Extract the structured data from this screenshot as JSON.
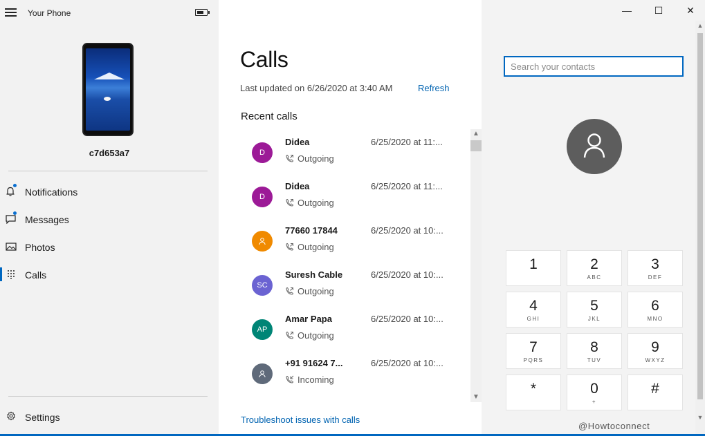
{
  "app": {
    "title": "Your Phone",
    "battery_level": 0.75
  },
  "device": {
    "name": "c7d653a7"
  },
  "nav": {
    "items": [
      {
        "id": "notifications",
        "label": "Notifications",
        "icon": "bell-icon",
        "badge": true
      },
      {
        "id": "messages",
        "label": "Messages",
        "icon": "message-icon",
        "badge": true
      },
      {
        "id": "photos",
        "label": "Photos",
        "icon": "image-icon",
        "badge": false
      },
      {
        "id": "calls",
        "label": "Calls",
        "icon": "dialpad-icon",
        "badge": false,
        "active": true
      }
    ],
    "settings_label": "Settings"
  },
  "main": {
    "title": "Calls",
    "last_updated": "Last updated on 6/26/2020 at 3:40 AM",
    "refresh_label": "Refresh",
    "recent_heading": "Recent calls",
    "troubleshoot_label": "Troubleshoot issues with calls",
    "calls": [
      {
        "name": "Didea",
        "initials": "D",
        "color": "#9c1a97",
        "time": "6/25/2020 at 11:...",
        "direction": "Outgoing"
      },
      {
        "name": "Didea",
        "initials": "D",
        "color": "#9c1a97",
        "time": "6/25/2020 at 11:...",
        "direction": "Outgoing"
      },
      {
        "name": "77660 17844",
        "initials": "",
        "color": "#f08a00",
        "time": "6/25/2020 at 10:...",
        "direction": "Outgoing"
      },
      {
        "name": "Suresh Cable",
        "initials": "SC",
        "color": "#6b63d2",
        "time": "6/25/2020 at 10:...",
        "direction": "Outgoing"
      },
      {
        "name": "Amar Papa",
        "initials": "AP",
        "color": "#008576",
        "time": "6/25/2020 at 10:...",
        "direction": "Outgoing"
      },
      {
        "name": "+91 91624 7...",
        "initials": "",
        "color": "#5f6a7a",
        "time": "6/25/2020 at 10:...",
        "direction": "Incoming"
      }
    ]
  },
  "dialer": {
    "search_placeholder": "Search your contacts",
    "keys": [
      {
        "digit": "1",
        "letters": ""
      },
      {
        "digit": "2",
        "letters": "ABC"
      },
      {
        "digit": "3",
        "letters": "DEF"
      },
      {
        "digit": "4",
        "letters": "GHI"
      },
      {
        "digit": "5",
        "letters": "JKL"
      },
      {
        "digit": "6",
        "letters": "MNO"
      },
      {
        "digit": "7",
        "letters": "PQRS"
      },
      {
        "digit": "8",
        "letters": "TUV"
      },
      {
        "digit": "9",
        "letters": "WXYZ"
      },
      {
        "digit": "*",
        "letters": ""
      },
      {
        "digit": "0",
        "letters": "+"
      },
      {
        "digit": "#",
        "letters": ""
      }
    ]
  },
  "window": {
    "minimize": "—",
    "maximize": "☐",
    "close": "✕"
  },
  "watermark": "@Howtoconnect",
  "colors": {
    "accent": "#0067c0",
    "link": "#0063b1"
  }
}
